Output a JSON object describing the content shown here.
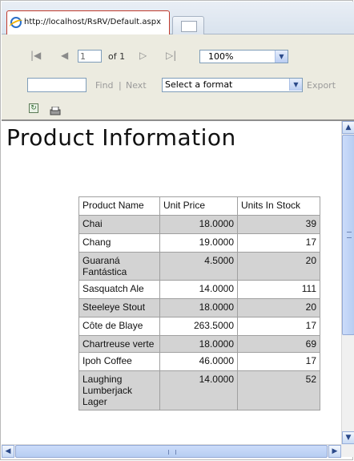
{
  "browser": {
    "tab_url": "http://localhost/RsRV/Default.aspx"
  },
  "report_toolbar": {
    "first_page_icon": "first-page-icon",
    "prev_page_icon": "previous-page-icon",
    "current_page": "1",
    "page_count_text": "of 1",
    "next_page_icon": "next-page-icon",
    "last_page_icon": "last-page-icon",
    "zoom": "100%",
    "find_label": "Find",
    "find_separator": "|",
    "next_label": "Next",
    "format_selected": "Select a format",
    "export_label": "Export",
    "refresh_icon": "refresh-icon",
    "print_icon": "print-icon"
  },
  "report": {
    "title": "Product Information",
    "columns": [
      "Product Name",
      "Unit Price",
      "Units In Stock"
    ],
    "rows": [
      {
        "name": "Chai",
        "price": "18.0000",
        "stock": "39"
      },
      {
        "name": "Chang",
        "price": "19.0000",
        "stock": "17"
      },
      {
        "name": "Guaraná Fantástica",
        "price": "4.5000",
        "stock": "20"
      },
      {
        "name": "Sasquatch Ale",
        "price": "14.0000",
        "stock": "111"
      },
      {
        "name": "Steeleye Stout",
        "price": "18.0000",
        "stock": "20"
      },
      {
        "name": "Côte de Blaye",
        "price": "263.5000",
        "stock": "17"
      },
      {
        "name": "Chartreuse verte",
        "price": "18.0000",
        "stock": "69"
      },
      {
        "name": "Ipoh Coffee",
        "price": "46.0000",
        "stock": "17"
      },
      {
        "name": "Laughing Lumberjack Lager",
        "price": "14.0000",
        "stock": "52"
      }
    ]
  },
  "colors": {
    "toolbar_bg": "#ecebe0",
    "alt_row_bg": "#d3d3d3",
    "active_tab_border": "#c0392b"
  }
}
